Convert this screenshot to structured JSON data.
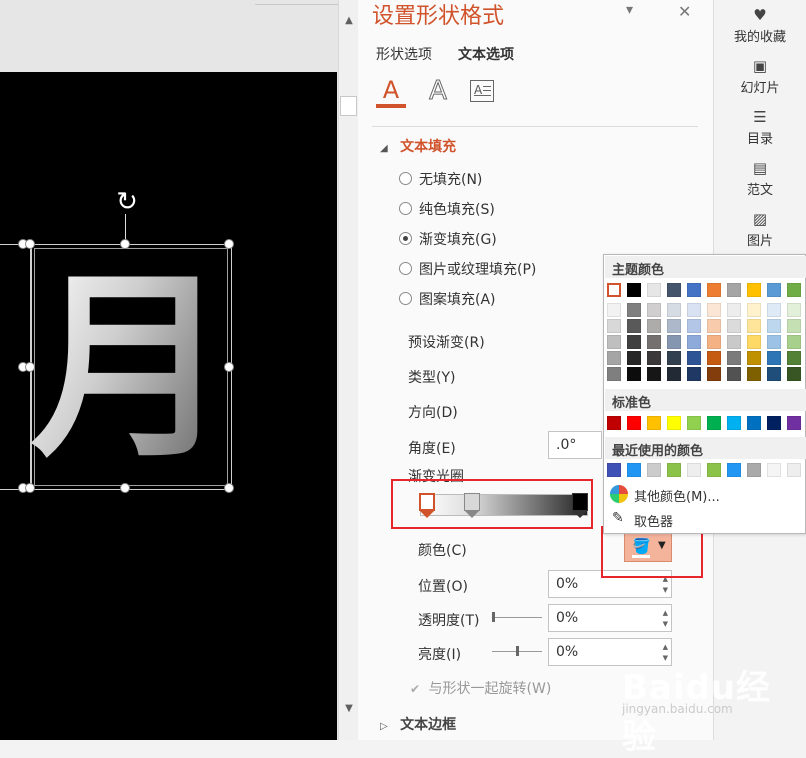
{
  "pane": {
    "title": "设置形状格式",
    "tabs": [
      "形状选项",
      "文本选项"
    ],
    "collapse_glyph": "▾",
    "close_glyph": "✕",
    "icon_tabs": [
      {
        "name": "text-fill-outline-icon",
        "glyph": "A"
      },
      {
        "name": "text-effects-icon",
        "glyph": "A"
      },
      {
        "name": "textbox-icon",
        "glyph": "A"
      }
    ],
    "section_fill": "文本填充",
    "section_border": "文本边框",
    "fill_options": [
      "无填充(N)",
      "纯色填充(S)",
      "渐变填充(G)",
      "图片或纹理填充(P)",
      "图案填充(A)"
    ],
    "fill_selected_index": 2,
    "preset_label": "预设渐变(R)",
    "type_label": "类型(Y)",
    "direction_label": "方向(D)",
    "angle_label": "角度(E)",
    "angle_value": ".0°",
    "stops_label": "渐变光圈",
    "color_label": "颜色(C)",
    "position_label": "位置(O)",
    "position_value": "0%",
    "transparency_label": "透明度(T)",
    "transparency_value": "0%",
    "brightness_label": "亮度(I)",
    "brightness_value": "0%",
    "rotate_label": "与形状一起旋转(W)",
    "rotate_checked": true
  },
  "slide": {
    "glyph": "月",
    "rotate_glyph": "↻",
    "background": "#000000"
  },
  "color_popup": {
    "theme_label": "主题颜色",
    "theme_top": [
      "#ffffff",
      "#000000",
      "#e7e6e6",
      "#44546a",
      "#4472c4",
      "#ed7d31",
      "#a5a5a5",
      "#ffc000",
      "#5b9bd5",
      "#70ad47"
    ],
    "theme_shades": [
      [
        "#f2f2f2",
        "#7f7f7f",
        "#d0cece",
        "#d6dce4",
        "#d9e2f3",
        "#fbe5d5",
        "#ededed",
        "#fff2cc",
        "#deebf6",
        "#e2efd9"
      ],
      [
        "#d8d8d8",
        "#595959",
        "#aeabab",
        "#adb9ca",
        "#b4c6e7",
        "#f7cbac",
        "#dbdbdb",
        "#fee599",
        "#bdd7ee",
        "#c5e0b3"
      ],
      [
        "#bfbfbf",
        "#3f3f3f",
        "#757070",
        "#8496b0",
        "#8eaadb",
        "#f4b183",
        "#c9c9c9",
        "#ffd965",
        "#9cc3e5",
        "#a8d08d"
      ],
      [
        "#a5a5a5",
        "#262626",
        "#3a3838",
        "#323f4f",
        "#2f5496",
        "#c55a11",
        "#7b7b7b",
        "#bf9000",
        "#2e75b5",
        "#538135"
      ],
      [
        "#7f7f7f",
        "#0c0c0c",
        "#171616",
        "#222a35",
        "#1f3864",
        "#833c0b",
        "#525252",
        "#7f6000",
        "#1e4e79",
        "#375623"
      ]
    ],
    "standard_label": "标准色",
    "standard": [
      "#c00000",
      "#ff0000",
      "#ffc000",
      "#ffff00",
      "#92d050",
      "#00b050",
      "#00b0f0",
      "#0070c0",
      "#002060",
      "#7030a0"
    ],
    "recent_label": "最近使用的颜色",
    "recent": [
      "#3f51b5",
      "#2196f3",
      "#cccccc",
      "#8bc34a",
      "#eeeeee",
      "#8bc34a",
      "#2196f3",
      "#aaaaaa",
      "#f5f5f5",
      "#eeeeee"
    ],
    "more_colors": "其他颜色(M)...",
    "eyedropper": "取色器"
  },
  "right_bar": {
    "items": [
      {
        "label": "我的收藏",
        "icon": "favorites-icon"
      },
      {
        "label": "幻灯片",
        "icon": "slides-icon"
      },
      {
        "label": "目录",
        "icon": "toc-icon"
      },
      {
        "label": "范文",
        "icon": "sample-doc-icon"
      },
      {
        "label": "图片",
        "icon": "image-icon"
      }
    ]
  },
  "watermark": {
    "text": "Baidu经验",
    "sub": "jingyan.baidu.com"
  },
  "colors": {
    "accent": "#d0532b",
    "highlight_box": "#e8252b",
    "color_button_bg": "#f4b49c"
  }
}
